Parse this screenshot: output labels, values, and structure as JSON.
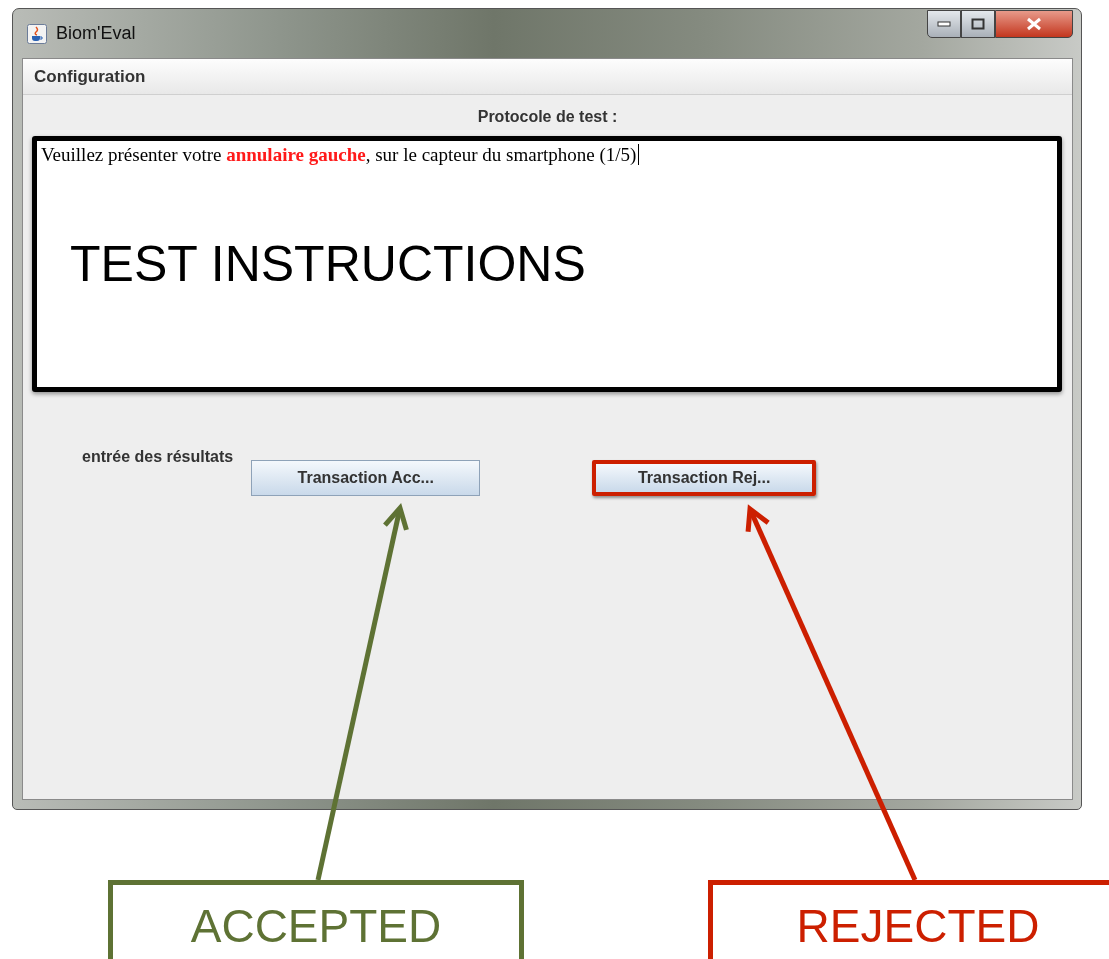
{
  "window": {
    "title": "Biom'Eval"
  },
  "menu": [
    {
      "label": "Configuration"
    }
  ],
  "protocol": {
    "label": "Protocole de test :",
    "instruction": "Veuillez présenter votre **annulaire gauche**, sur le capteur du smartphone (1/5)"
  },
  "results": {
    "label": "entrée des résultats",
    "buttons": [
      {
        "label": "Transaction Acc...",
        "outlined": false
      },
      {
        "label": "Transaction Rej...",
        "outlined": true
      }
    ]
  },
  "annotations": {
    "instructions_label": "TEST INSTRUCTIONS",
    "callouts": [
      {
        "label": "ACCEPTED",
        "color": "#5e7234"
      },
      {
        "label": "REJECTED",
        "color": "#cc1f00"
      }
    ]
  }
}
